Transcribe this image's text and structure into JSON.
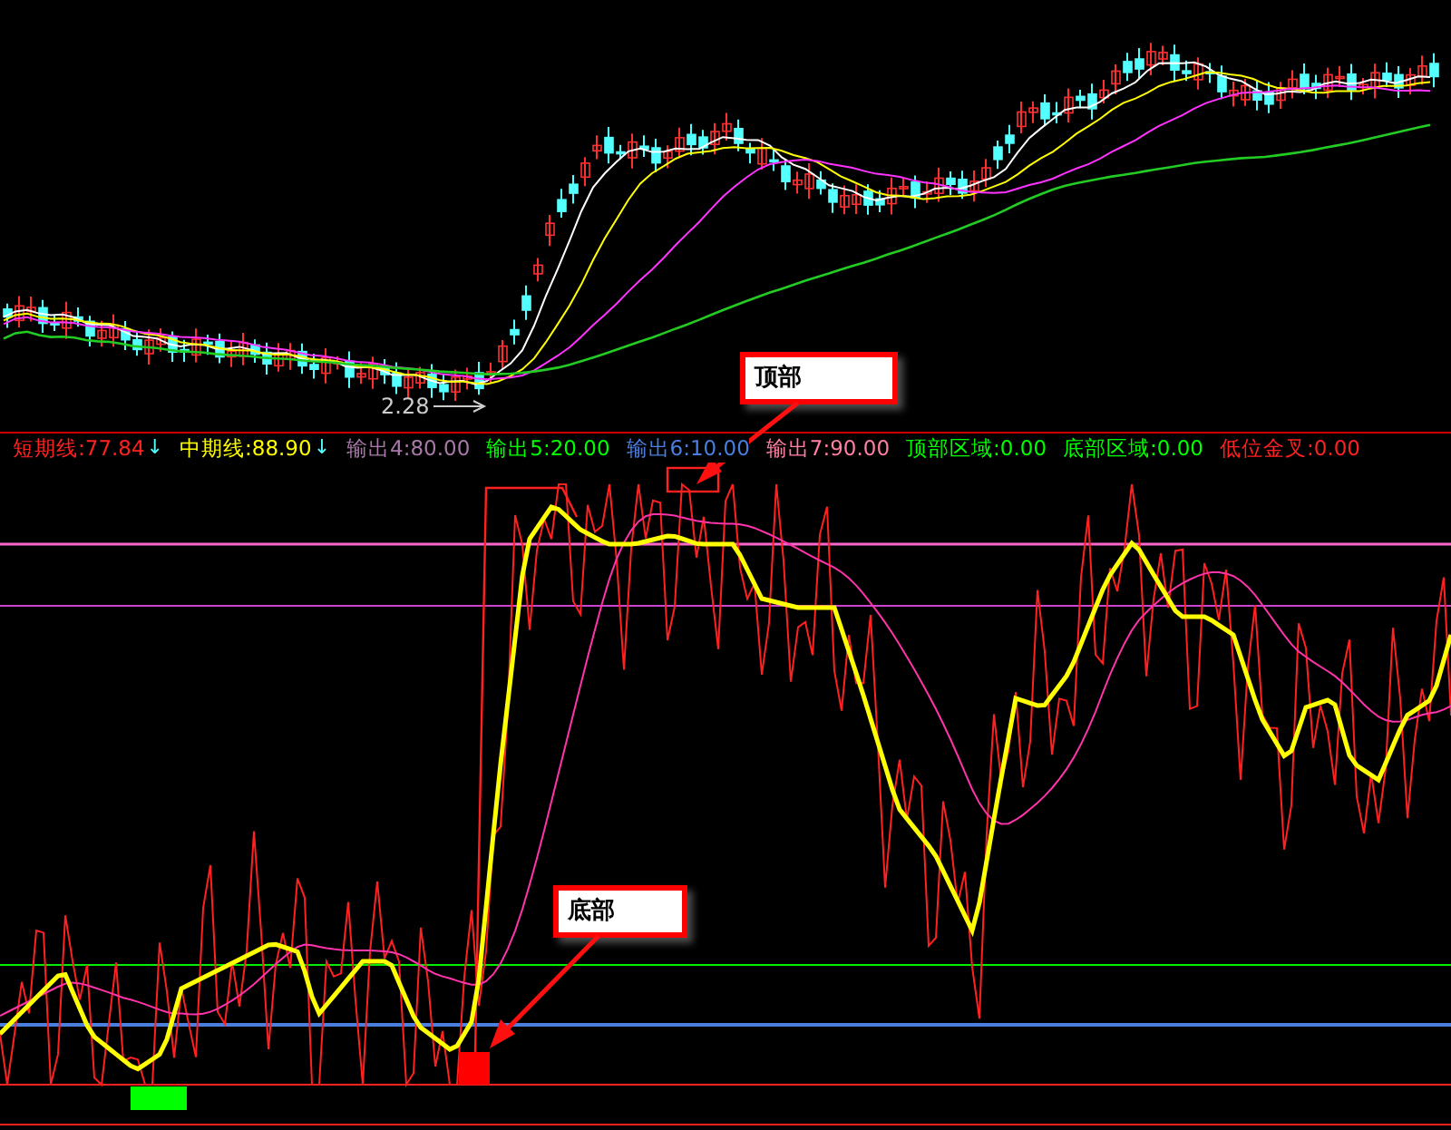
{
  "price_chart": {
    "low_label": "2.28"
  },
  "indicator_legend": [
    {
      "label": "短期线:77.84",
      "color": "#ff2020",
      "arrow": "↓"
    },
    {
      "label": "中期线:88.90",
      "color": "#ffff00",
      "arrow": "↓"
    },
    {
      "label": "输出4:80.00",
      "color": "#a878a8"
    },
    {
      "label": "输出5:20.00",
      "color": "#00ff00"
    },
    {
      "label": "输出6:10.00",
      "color": "#4a7fe0"
    },
    {
      "label": "输出7:90.00",
      "color": "#ff80a0"
    },
    {
      "label": "顶部区域:0.00",
      "color": "#00ff00"
    },
    {
      "label": "底部区域:0.00",
      "color": "#00ff00"
    },
    {
      "label": "低位金叉:0.00",
      "color": "#ff2020"
    }
  ],
  "callouts": [
    {
      "kind": "top",
      "text": "顶部"
    },
    {
      "kind": "bottom",
      "text": "底部"
    }
  ]
}
